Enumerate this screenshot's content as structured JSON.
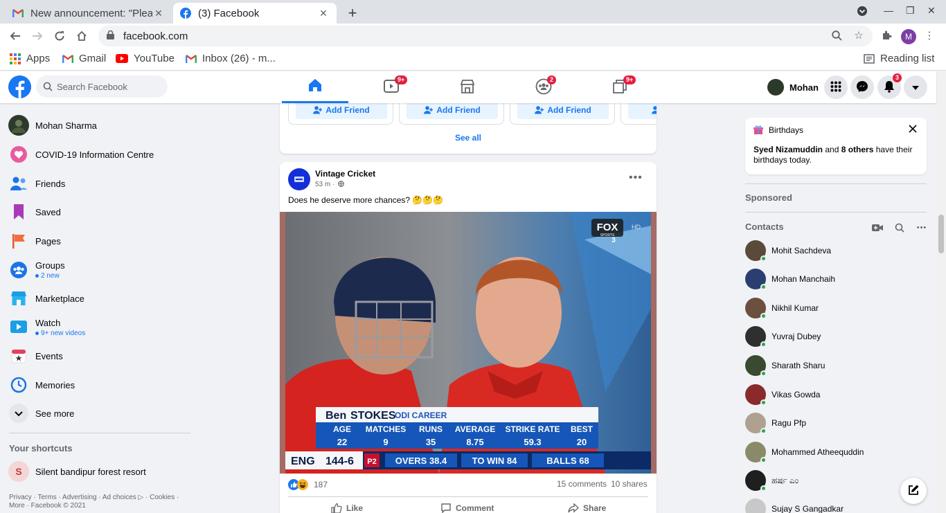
{
  "browser": {
    "tabs": [
      {
        "title": "New announcement: \"Plea",
        "active": false
      },
      {
        "title": "(3) Facebook",
        "active": true
      }
    ],
    "url": "facebook.com",
    "profile_initial": "M",
    "bookmarks": [
      "Apps",
      "Gmail",
      "YouTube",
      "Inbox (26) - m..."
    ],
    "reading_list": "Reading list"
  },
  "fb_header": {
    "search_placeholder": "Search Facebook",
    "badges": {
      "watch": "9+",
      "groups": "2",
      "gaming": "9+",
      "notifications": "3"
    },
    "user_name": "Mohan",
    "brand_color": "#1877f2"
  },
  "left_nav": {
    "items": [
      {
        "label": "Mohan Sharma"
      },
      {
        "label": "COVID-19 Information Centre"
      },
      {
        "label": "Friends"
      },
      {
        "label": "Saved"
      },
      {
        "label": "Pages"
      },
      {
        "label": "Groups",
        "sub": "2 new"
      },
      {
        "label": "Marketplace"
      },
      {
        "label": "Watch",
        "sub": "9+ new videos"
      },
      {
        "label": "Events"
      },
      {
        "label": "Memories"
      },
      {
        "label": "See more"
      }
    ],
    "shortcuts_title": "Your shortcuts",
    "shortcuts": [
      {
        "initial": "S",
        "label": "Silent bandipur forest resort"
      }
    ],
    "footer": "Privacy · Terms · Advertising · Ad choices ▷ · Cookies · More · Facebook © 2021"
  },
  "people_you_may_know": {
    "add_friend_label": "Add Friend",
    "see_all": "See all"
  },
  "post": {
    "page_name": "Vintage Cricket",
    "time": "53 m ·",
    "text": "Does he deserve more chances? 🤔🤔🤔",
    "image": {
      "channel_logo": "FOX",
      "channel_sub": "SPORTS",
      "channel_num": "3",
      "hd": "HD",
      "player_first": "Ben",
      "player_last": "STOKES",
      "career": "ODI CAREER",
      "stat_headers": [
        "AGE",
        "MATCHES",
        "RUNS",
        "AVERAGE",
        "STRIKE RATE",
        "BEST"
      ],
      "stat_values": [
        "22",
        "9",
        "35",
        "8.75",
        "59.3",
        "20"
      ],
      "team": "ENG",
      "score": "144-6",
      "period": "P2",
      "overs": "OVERS 38.4",
      "to_win": "TO WIN 84",
      "balls": "BALLS 68"
    },
    "reaction_count": "187",
    "comments": "15 comments",
    "shares": "10 shares",
    "actions": [
      "Like",
      "Comment",
      "Share"
    ]
  },
  "right_col": {
    "birthdays": {
      "title": "Birthdays",
      "name1": "Syed Nizamuddin",
      "and": " and ",
      "name2": "8 others",
      "rest": " have their birthdays today."
    },
    "sponsored": "Sponsored",
    "contacts_title": "Contacts",
    "contacts": [
      {
        "name": "Mohit Sachdeva",
        "color": "#5a4a3a"
      },
      {
        "name": "Mohan Manchaih",
        "color": "#2a3f6f"
      },
      {
        "name": "Nikhil Kumar",
        "color": "#6b5040"
      },
      {
        "name": "Yuvraj Dubey",
        "color": "#2f2f2f"
      },
      {
        "name": "Sharath Sharu",
        "color": "#3a4a30"
      },
      {
        "name": "Vikas Gowda",
        "color": "#8a2a2a"
      },
      {
        "name": "Ragu Pfp",
        "color": "#b0a090"
      },
      {
        "name": "Mohammed Atheequddin",
        "color": "#8a8a6a"
      },
      {
        "name": "ಹರ್ಷ ಎಂ",
        "color": "#1f1f1f"
      },
      {
        "name": "Sujay S Gangadkar",
        "color": "#c8c8c8"
      }
    ]
  }
}
